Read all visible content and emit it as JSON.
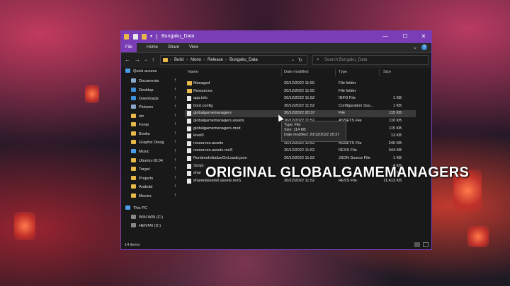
{
  "window": {
    "title": "Bungaku_Data"
  },
  "ribbon": {
    "tabs": [
      "File",
      "Home",
      "Share",
      "View"
    ]
  },
  "address": {
    "crumbs": [
      "Build",
      "Mono",
      "Release",
      "Bungaku_Data"
    ],
    "search_placeholder": "Search Bungaku_Data"
  },
  "sidebar": {
    "items": [
      {
        "label": "Quick access",
        "icon": "star-icon",
        "color": "#4a9fe8"
      },
      {
        "label": "Documents",
        "icon": "documents-icon",
        "color": "#8aa8c8",
        "pinned": true
      },
      {
        "label": "Desktop",
        "icon": "desktop-icon",
        "color": "#3d8fd9",
        "pinned": true
      },
      {
        "label": "Downloads",
        "icon": "download-icon",
        "color": "#3d8fd9",
        "pinned": true
      },
      {
        "label": "Pictures",
        "icon": "pictures-icon",
        "color": "#8aa8c8",
        "pinned": true
      },
      {
        "label": "etc",
        "icon": "folder-icon",
        "color": "#e8b84a",
        "pinned": true
      },
      {
        "label": "Fonts",
        "icon": "fonts-icon",
        "color": "#e8b84a",
        "pinned": true
      },
      {
        "label": "Books",
        "icon": "folder-icon",
        "color": "#e8b84a",
        "pinned": true
      },
      {
        "label": "Graphic Desig",
        "icon": "folder-icon",
        "color": "#e8b84a",
        "pinned": true
      },
      {
        "label": "Music",
        "icon": "music-icon",
        "color": "#4a9fe8",
        "pinned": true
      },
      {
        "label": "Ubuntu-18.04",
        "icon": "folder-icon",
        "color": "#e8b84a",
        "pinned": true
      },
      {
        "label": "Target",
        "icon": "folder-icon",
        "color": "#e8b84a",
        "pinned": true
      },
      {
        "label": "Projects",
        "icon": "folder-icon",
        "color": "#e8b84a",
        "pinned": true
      },
      {
        "label": "Android",
        "icon": "folder-icon",
        "color": "#e8b84a",
        "pinned": true
      },
      {
        "label": "Movies",
        "icon": "folder-icon",
        "color": "#e8b84a",
        "pinned": true
      },
      {
        "label": "This PC",
        "icon": "computer-icon",
        "color": "#4a9fe8"
      },
      {
        "label": "WIN WIN (C:)",
        "icon": "drive-icon",
        "color": "#8a8a8a"
      },
      {
        "label": "HENTAI (D:)",
        "icon": "drive-icon",
        "color": "#8a8a8a"
      }
    ]
  },
  "columns": {
    "name": "Name",
    "date": "Date modified",
    "type": "Type",
    "size": "Size"
  },
  "files": [
    {
      "name": "Managed",
      "date": "20/12/2022 11:55",
      "type": "File folder",
      "size": "",
      "kind": "folder"
    },
    {
      "name": "Resources",
      "date": "20/12/2022 11:55",
      "type": "File folder",
      "size": "",
      "kind": "folder"
    },
    {
      "name": "app.info",
      "date": "20/12/2022 11:52",
      "type": "INFO File",
      "size": "1 KB",
      "kind": "file"
    },
    {
      "name": "boot.config",
      "date": "20/12/2022 11:52",
      "type": "Configuration Sou...",
      "size": "1 KB",
      "kind": "file"
    },
    {
      "name": "globalgamemanagers",
      "date": "20/12/2022 20:37",
      "type": "File",
      "size": "115 KB",
      "kind": "file",
      "selected": true
    },
    {
      "name": "globalgamemanagers.assets",
      "date": "20/12/2022 11:52",
      "type": "ASSETS File",
      "size": "110 KB",
      "kind": "file"
    },
    {
      "name": "globalgamemanagers-mod",
      "date": "",
      "type": "",
      "size": "115 KB",
      "kind": "file"
    },
    {
      "name": "level0",
      "date": "",
      "type": "",
      "size": "13 KB",
      "kind": "file"
    },
    {
      "name": "resources.assets",
      "date": "20/12/2022 11:52",
      "type": "ASSETS File",
      "size": "240 KB",
      "kind": "file"
    },
    {
      "name": "resources.assets.resS",
      "date": "20/12/2022 11:52",
      "type": "RESS File",
      "size": "344 KB",
      "kind": "file"
    },
    {
      "name": "RuntimeInitializeOnLoads.json",
      "date": "20/12/2022 11:52",
      "type": "JSON Source File",
      "size": "1 KB",
      "kind": "file"
    },
    {
      "name": "Script",
      "date": "",
      "type": "",
      "size": "4 KB",
      "kind": "file"
    },
    {
      "name": "shar",
      "date": "",
      "type": "",
      "size": "308 KB",
      "kind": "file"
    },
    {
      "name": "sharedassets0.assets.resS",
      "date": "20/12/2022 11:52",
      "type": "RESS File",
      "size": "11,413 KB",
      "kind": "file"
    }
  ],
  "tooltip": {
    "type": "Type: File",
    "size": "Size: 114 KB",
    "date": "Date modified: 20/12/2022 20:37"
  },
  "status": {
    "items": "14 items"
  },
  "caption": "ORIGINAL GLOBALGAMEMANAGERS"
}
